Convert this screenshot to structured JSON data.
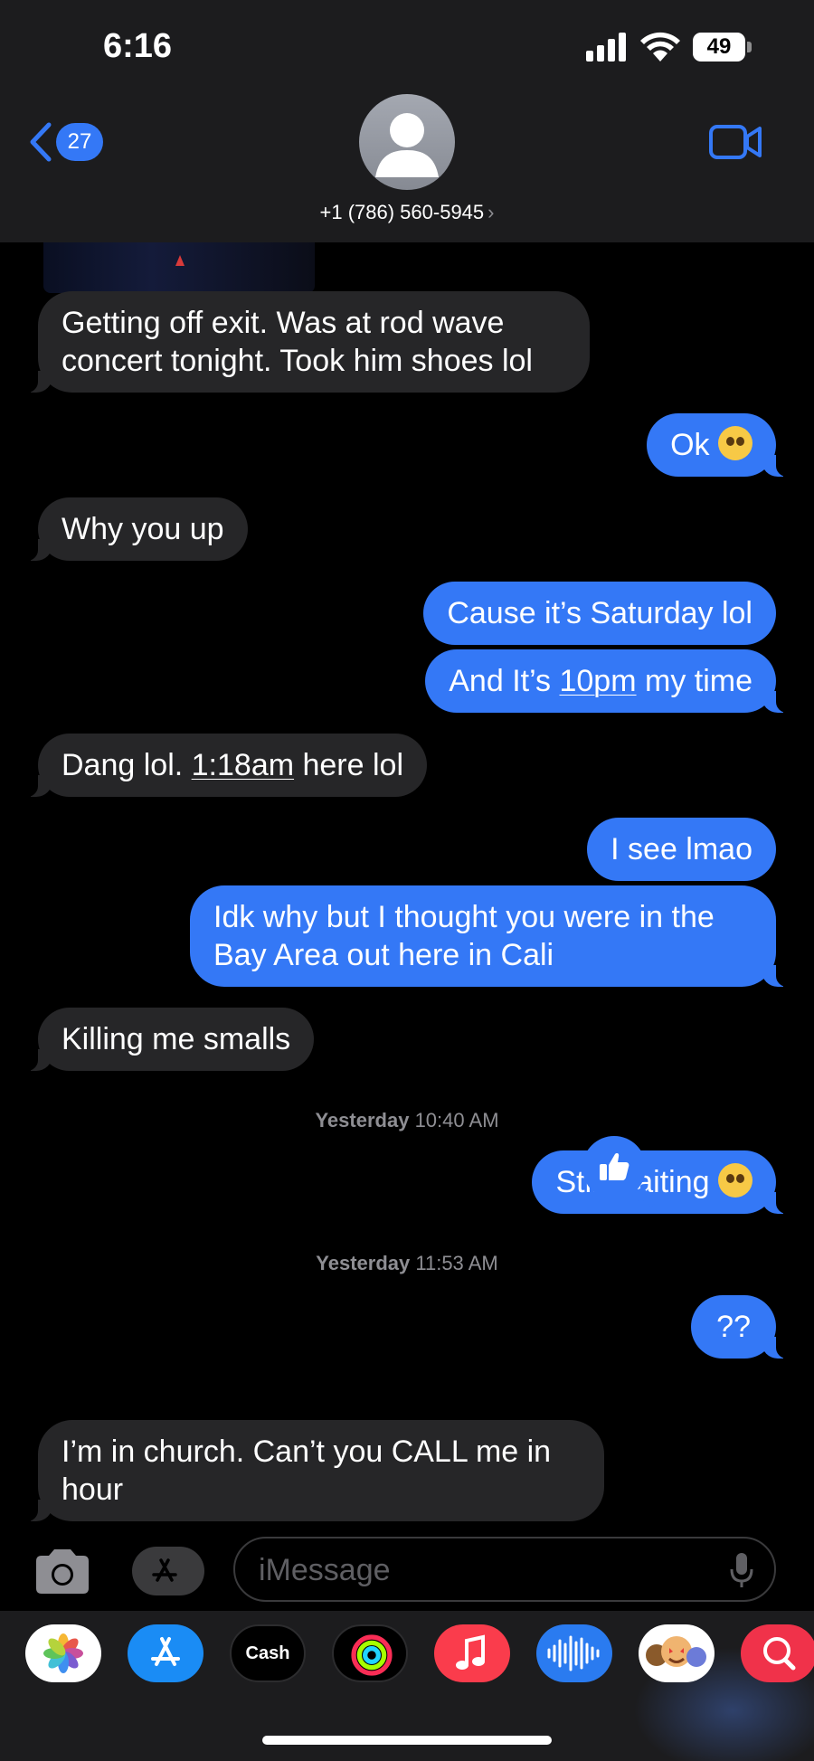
{
  "status_bar": {
    "time": "6:16",
    "battery": "49"
  },
  "header": {
    "back_count": "27",
    "contact": "+1 (786) 560-5945",
    "contact_chevron": "›"
  },
  "messages": [
    {
      "dir": "in",
      "text": "Getting off exit. Was at rod wave concert tonight. Took him shoes lol"
    },
    {
      "dir": "out",
      "text": "Ok",
      "emoji": "pleading-face"
    },
    {
      "dir": "in",
      "text": "Why you up"
    },
    {
      "dir": "out",
      "text": "Cause it’s Saturday lol"
    },
    {
      "dir": "out",
      "text_before": "And It’s ",
      "text_link": "10pm",
      "text_after": " my time"
    },
    {
      "dir": "in",
      "text_before": "Dang lol. ",
      "text_link": "1:18am",
      "text_after": " here lol"
    },
    {
      "dir": "out",
      "text": "I see lmao"
    },
    {
      "dir": "out",
      "text": "Idk why but I thought you were in the Bay Area out here in Cali"
    },
    {
      "dir": "in",
      "text": "Killing me smalls"
    },
    {
      "dir": "out",
      "text": "Still waiting",
      "emoji": "holding-back-tears-face"
    },
    {
      "dir": "out",
      "text": "??"
    },
    {
      "dir": "in",
      "text": "I’m in church. Can’t you CALL me in hour",
      "tapback": "thumbs-up"
    }
  ],
  "timestamps": [
    {
      "day": "Yesterday",
      "time": "10:40 AM"
    },
    {
      "day": "Yesterday",
      "time": "11:53 AM"
    }
  ],
  "input": {
    "placeholder": "iMessage"
  },
  "drawer_apps": [
    {
      "name": "Photos",
      "icon": "photos-icon",
      "color": "#ffffff"
    },
    {
      "name": "App Store",
      "icon": "app-store-icon",
      "color": "#1a8cf5"
    },
    {
      "name": "Cash",
      "label": "Cash",
      "icon": "apple-cash-icon",
      "color": "#000000"
    },
    {
      "name": "Activity",
      "icon": "activity-icon",
      "color": "#000000"
    },
    {
      "name": "Music",
      "icon": "music-icon",
      "color": "#fa3c4c"
    },
    {
      "name": "Audio",
      "icon": "audio-message-icon",
      "color": "#2a7bf0"
    },
    {
      "name": "Memoji",
      "icon": "memoji-icon",
      "color": "#ffffff"
    },
    {
      "name": "Images",
      "icon": "image-search-icon",
      "color": "#f0324a"
    }
  ],
  "colors": {
    "outgoing": "#3478f6",
    "incoming": "#262628",
    "header": "#1c1c1e"
  }
}
